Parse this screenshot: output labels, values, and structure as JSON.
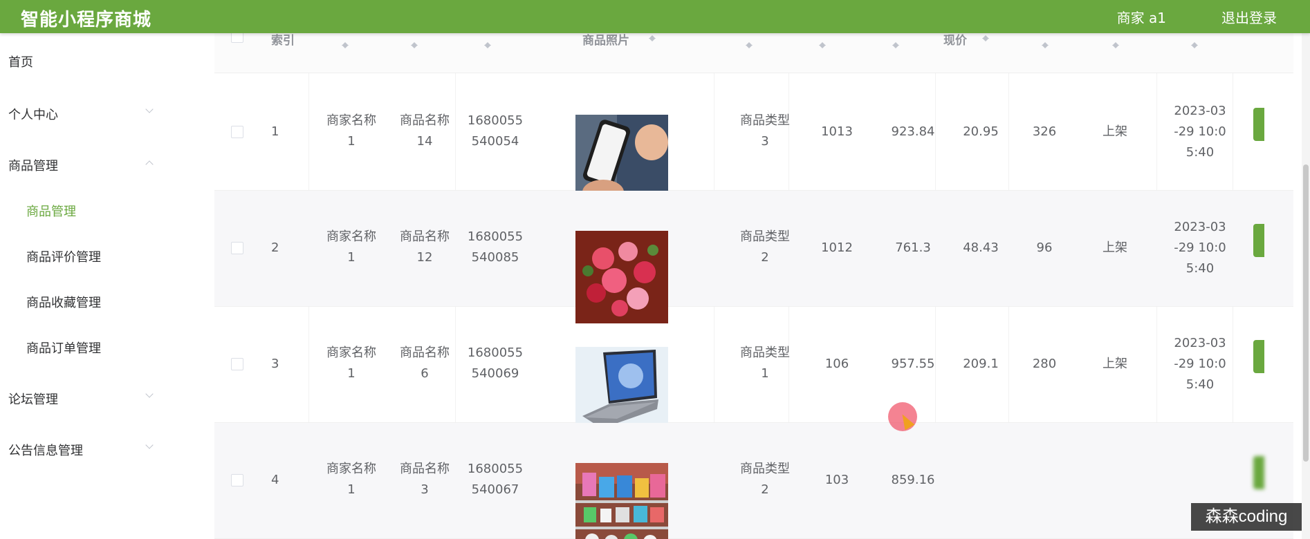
{
  "header": {
    "title": "智能小程序商城",
    "user": "商家 a1",
    "logout": "退出登录"
  },
  "sidebar": {
    "items": [
      {
        "label": "首页"
      },
      {
        "label": "个人中心"
      },
      {
        "label": "商品管理"
      },
      {
        "label": "商品管理"
      },
      {
        "label": "商品评价管理"
      },
      {
        "label": "商品收藏管理"
      },
      {
        "label": "商品订单管理"
      },
      {
        "label": "论坛管理"
      },
      {
        "label": "公告信息管理"
      }
    ]
  },
  "table": {
    "headers": [
      "索引",
      "商品照片",
      "现价"
    ],
    "rows": [
      {
        "index": "1",
        "merchant": [
          "商家名称",
          "1"
        ],
        "name": [
          "商品名称",
          "14"
        ],
        "code": [
          "1680055",
          "540054"
        ],
        "category": [
          "商品类型",
          "3"
        ],
        "c1": "1013",
        "c2": "923.84",
        "c3": "20.95",
        "c4": "326",
        "status": "上架",
        "time": [
          "2023-03",
          "-29 10:0",
          "5:40"
        ],
        "photo": "phone"
      },
      {
        "index": "2",
        "merchant": [
          "商家名称",
          "1"
        ],
        "name": [
          "商品名称",
          "12"
        ],
        "code": [
          "1680055",
          "540085"
        ],
        "category": [
          "商品类型",
          "2"
        ],
        "c1": "1012",
        "c2": "761.3",
        "c3": "48.43",
        "c4": "96",
        "status": "上架",
        "time": [
          "2023-03",
          "-29 10:0",
          "5:40"
        ],
        "photo": "flowers"
      },
      {
        "index": "3",
        "merchant": [
          "商家名称",
          "1"
        ],
        "name": [
          "商品名称",
          "6"
        ],
        "code": [
          "1680055",
          "540069"
        ],
        "category": [
          "商品类型",
          "1"
        ],
        "c1": "106",
        "c2": "957.55",
        "c3": "209.1",
        "c4": "280",
        "status": "上架",
        "time": [
          "2023-03",
          "-29 10:0",
          "5:40"
        ],
        "photo": "laptop"
      },
      {
        "index": "4",
        "merchant": [
          "商家名称",
          "1"
        ],
        "name": [
          "商品名称",
          "3"
        ],
        "code": [
          "1680055",
          "540067"
        ],
        "category": [
          "商品类型",
          "2"
        ],
        "c1": "103",
        "c2": "859.16",
        "c3": "",
        "c4": "",
        "status": "",
        "time": [
          "",
          "",
          ""
        ],
        "photo": "shelf"
      }
    ]
  },
  "watermark": "森森coding",
  "colors": {
    "brand": "#6aa83f",
    "active": "#6aa83f"
  }
}
